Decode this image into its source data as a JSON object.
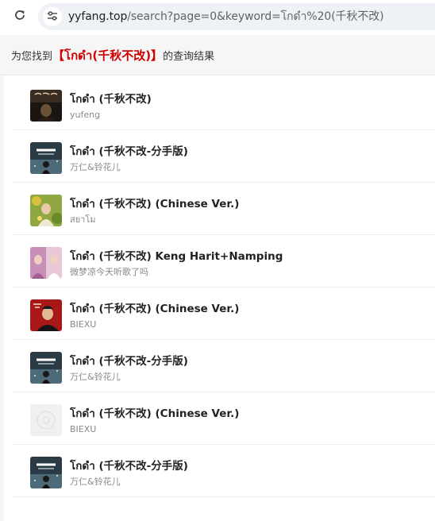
{
  "browser": {
    "url_host": "yyfang.top",
    "url_path": "/search?page=0&keyword=โกดำ%20(千秋不改)"
  },
  "header": {
    "prefix": "为您找到",
    "bracket_open": "【",
    "keyword": "โกดำ(千秋不改)",
    "bracket_close": "】",
    "suffix": "的查询结果"
  },
  "songs": [
    {
      "title": "โกดำ (千秋不改)",
      "artist": "yufeng",
      "cover_icon": "dark-portrait-cover"
    },
    {
      "title": "โกดำ (千秋不改-分手版)",
      "artist": "万仁&铃花儿",
      "cover_icon": "dark-poster-cover"
    },
    {
      "title": "โกดำ (千秋不改) (Chinese Ver.)",
      "artist": "สยาโม",
      "cover_icon": "floral-portrait-cover"
    },
    {
      "title": "โกดำ (千秋不改) Keng Harit+Namping",
      "artist": "微梦凉今天听歌了吗",
      "cover_icon": "pink-duo-cover"
    },
    {
      "title": "โกดำ (千秋不改) (Chinese Ver.)",
      "artist": "BIEXU",
      "cover_icon": "red-portrait-cover"
    },
    {
      "title": "โกดำ (千秋不改-分手版)",
      "artist": "万仁&铃花儿",
      "cover_icon": "dark-poster-cover"
    },
    {
      "title": "โกดำ (千秋不改) (Chinese Ver.)",
      "artist": "BIEXU",
      "cover_icon": "disc-placeholder-cover"
    },
    {
      "title": "โกดำ (千秋不改-分手版)",
      "artist": "万仁&铃花儿",
      "cover_icon": "dark-poster-cover"
    }
  ],
  "colors": {
    "keyword": "#d10000",
    "header_bg": "#f6f6f6",
    "omnibox_bg": "#eef1f5"
  }
}
